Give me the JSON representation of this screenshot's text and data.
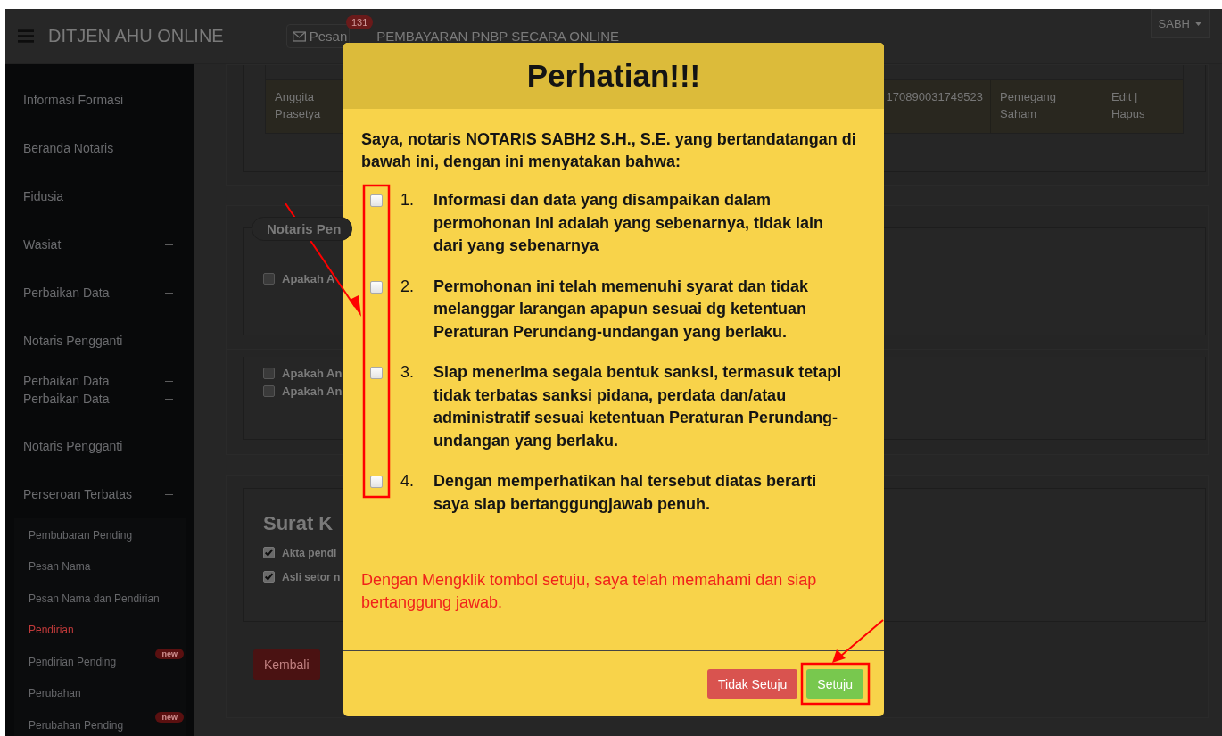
{
  "navbar": {
    "brand": "DITJEN AHU ONLINE",
    "messages": {
      "label": "Pesan",
      "count": "131"
    },
    "payment_link": "PEMBAYARAN PNBP SECARA ONLINE",
    "user": "SABH"
  },
  "sidebar": {
    "items": [
      {
        "label": "Informasi Formasi",
        "expandable": false,
        "selected": false
      },
      {
        "label": "Beranda Notaris",
        "expandable": false,
        "selected": false
      },
      {
        "label": "Fidusia",
        "expandable": false,
        "selected": false
      },
      {
        "label": "Wasiat",
        "expandable": true,
        "selected": false
      },
      {
        "label": "Perbaikan Data",
        "expandable": true,
        "selected": false
      },
      {
        "label": "Notaris Pengganti",
        "expandable": false,
        "selected": false
      },
      {
        "label": "Perbaikan Data",
        "expandable": true,
        "selected": false
      },
      {
        "label": "Perbaikan Data",
        "expandable": true,
        "selected": false
      },
      {
        "label": "Notaris Pengganti",
        "expandable": false,
        "selected": false
      },
      {
        "label": "Perseroan Terbatas",
        "expandable": true,
        "selected": false,
        "children": [
          {
            "label": "Pembubaran Pending",
            "selected": false
          },
          {
            "label": "Pesan Nama",
            "selected": false
          },
          {
            "label": "Pesan Nama dan Pendirian",
            "selected": false
          },
          {
            "label": "Pendirian",
            "selected": true
          },
          {
            "label": "Pendirian Pending",
            "selected": false,
            "badge": "new"
          },
          {
            "label": "Perubahan",
            "selected": false
          },
          {
            "label": "Perubahan Pending",
            "selected": false,
            "badge": "new"
          }
        ]
      }
    ]
  },
  "main": {
    "table_row": {
      "name": "Anggita Prasetya",
      "id_number": "170890031749523",
      "role": "Pemegang Saham",
      "actions": "Edit | Hapus"
    },
    "notaris_section": {
      "legend": "Notaris Pen",
      "checks": [
        {
          "label": "Apakah A",
          "checked": false
        }
      ]
    },
    "questions": {
      "checks": [
        {
          "label": "Apakah An",
          "checked": false
        },
        {
          "label": "Apakah An",
          "checked": false
        }
      ]
    },
    "letter_section": {
      "heading": "Surat K",
      "checks": [
        {
          "label": "Akta pendi",
          "checked": true
        },
        {
          "label": "Asli setor n",
          "checked": true
        }
      ]
    },
    "back_button": "Kembali"
  },
  "modal": {
    "title": "Perhatian!!!",
    "intro": "Saya, notaris NOTARIS SABH2 S.H., S.E. yang bertandatangan di bawah ini, dengan ini menyatakan bahwa:",
    "statements": [
      {
        "number": "1.",
        "text": "Informasi dan data yang disampaikan dalam permohonan ini adalah yang sebenarnya, tidak lain dari yang sebenarnya",
        "checked": false
      },
      {
        "number": "2.",
        "text": "Permohonan ini telah memenuhi syarat dan tidak melanggar larangan apapun sesuai dg ketentuan Peraturan Perundang-undangan yang berlaku.",
        "checked": false
      },
      {
        "number": "3.",
        "text": "Siap menerima segala bentuk sanksi, termasuk tetapi tidak terbatas sanksi pidana, perdata dan/atau administratif sesuai ketentuan Peraturan Perundang-undangan yang berlaku.",
        "checked": false
      },
      {
        "number": "4.",
        "text": "Dengan memperhatikan hal tersebut diatas berarti saya siap bertanggungjawab penuh.",
        "checked": false
      }
    ],
    "note": "Dengan Mengklik tombol setuju, saya telah memahami dan siap bertanggung jawab.",
    "buttons": [
      {
        "label": "Tidak Setuju",
        "kind": "danger"
      },
      {
        "label": "Setuju",
        "kind": "success"
      }
    ]
  }
}
